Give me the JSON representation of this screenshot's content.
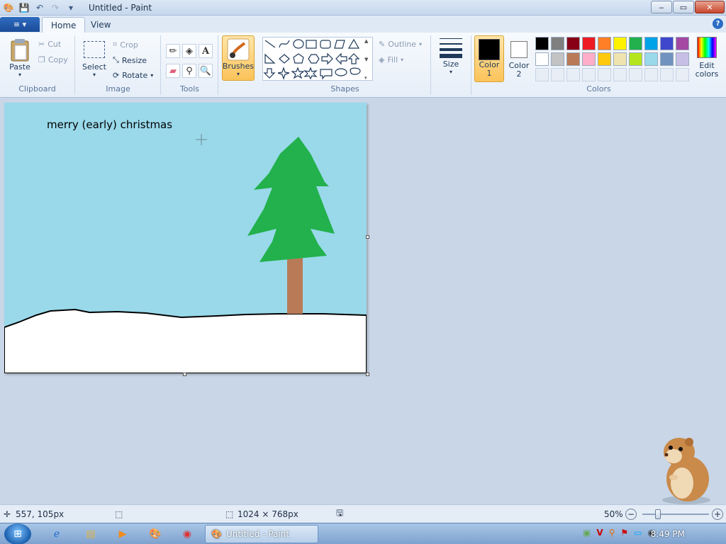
{
  "window": {
    "title": "Untitled - Paint"
  },
  "titlebar": {
    "minimize": "‒",
    "maximize": "▭",
    "close": "✕"
  },
  "tabs": {
    "file_icon": "≡ ▾",
    "home": "Home",
    "view": "View",
    "help": "?"
  },
  "clipboard": {
    "paste": "Paste",
    "cut": "Cut",
    "copy": "Copy",
    "group": "Clipboard"
  },
  "image": {
    "select": "Select",
    "crop": "Crop",
    "resize": "Resize",
    "rotate": "Rotate",
    "group": "Image"
  },
  "tools": {
    "group": "Tools",
    "text_tool": "A"
  },
  "brushes": {
    "label": "Brushes"
  },
  "shapes": {
    "outline": "Outline",
    "fill": "Fill",
    "group": "Shapes"
  },
  "size": {
    "label": "Size"
  },
  "colors": {
    "color1_line1": "Color",
    "color1_line2": "1",
    "color2_line1": "Color",
    "color2_line2": "2",
    "edit_line1": "Edit",
    "edit_line2": "colors",
    "group": "Colors",
    "color1_value": "#000000",
    "color2_value": "#ffffff",
    "palette_row1": [
      "#000000",
      "#7f7f7f",
      "#880015",
      "#ed1c24",
      "#ff7f27",
      "#fff200",
      "#22b14c",
      "#00a2e8",
      "#3f48cc",
      "#a349a4"
    ],
    "palette_row2": [
      "#ffffff",
      "#c3c3c3",
      "#b97a57",
      "#ffaec9",
      "#ffc90e",
      "#efe4b0",
      "#b5e61d",
      "#99d9ea",
      "#7092be",
      "#c8bfe7"
    ]
  },
  "canvas": {
    "text": "merry (early) christmas",
    "sky_color": "#99d9ea",
    "tree_color": "#22b14c",
    "trunk_color": "#b97a57"
  },
  "status": {
    "cursor_pos": "557, 105px",
    "image_size": "1024 × 768px",
    "zoom": "50%",
    "zoom_out": "−",
    "zoom_in": "+"
  },
  "taskbar": {
    "task_label": "Untitled - Paint",
    "clock": "8:49 PM"
  }
}
